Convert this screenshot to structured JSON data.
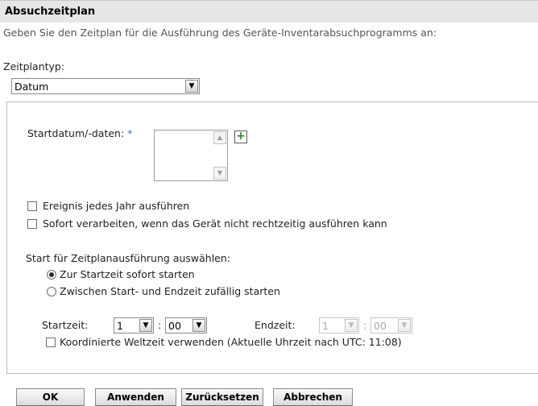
{
  "header": {
    "title": "Absuchzeitplan"
  },
  "description": "Geben Sie den Zeitplan für die Ausführung des Geräte-Inventarabsuchprogramms an:",
  "schedule_type": {
    "label": "Zeitplantyp:",
    "value": "Datum"
  },
  "start_dates": {
    "label": "Startdatum/-daten:",
    "required_mark": "*"
  },
  "options": {
    "yearly": "Ereignis jedes Jahr ausführen",
    "process_immediately": "Sofort verarbeiten, wenn das Gerät nicht rechtzeitig ausführen kann"
  },
  "start_selection": {
    "label": "Start für Zeitplanausführung auswählen:",
    "opt_start_time": "Zur Startzeit sofort starten",
    "opt_random": "Zwischen Start- und Endzeit zufällig starten"
  },
  "time": {
    "start_label": "Startzeit:",
    "start_hour": "1",
    "start_min": "00",
    "end_label": "Endzeit:",
    "end_hour": "1",
    "end_min": "00",
    "separator": ":",
    "utc_label": "Koordinierte Weltzeit verwenden (Aktuelle Uhrzeit nach UTC: 11:08)"
  },
  "buttons": {
    "ok": "OK",
    "apply": "Anwenden",
    "reset": "Zurücksetzen",
    "cancel": "Abbrechen"
  },
  "icons": {
    "dropdown": "chevron-down-icon",
    "add": "plus-icon",
    "scroll_up": "arrow-up-icon",
    "scroll_down": "arrow-down-icon"
  }
}
